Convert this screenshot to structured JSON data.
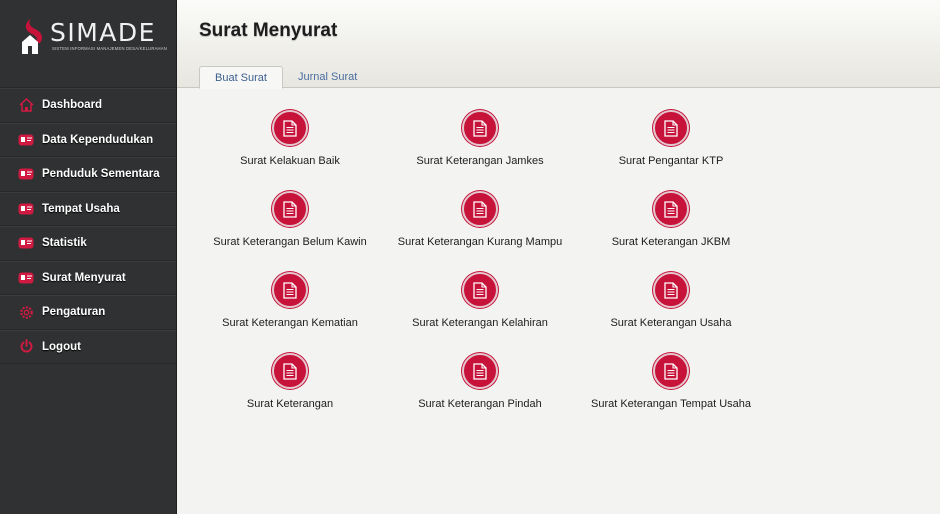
{
  "app": {
    "logo_title": "SIMADE",
    "logo_subtitle": "SISTEM INFORMASI MANAJEMEN DESA/KELURAHAN",
    "brand_color": "#c7123a"
  },
  "sidebar": {
    "items": [
      {
        "label": "Dashboard",
        "icon": "home-icon"
      },
      {
        "label": "Data Kependudukan",
        "icon": "id-card-icon"
      },
      {
        "label": "Penduduk Sementara",
        "icon": "id-card-icon"
      },
      {
        "label": "Tempat Usaha",
        "icon": "id-card-icon"
      },
      {
        "label": "Statistik",
        "icon": "id-card-icon"
      },
      {
        "label": "Surat Menyurat",
        "icon": "id-card-icon"
      },
      {
        "label": "Pengaturan",
        "icon": "gear-icon"
      },
      {
        "label": "Logout",
        "icon": "power-icon"
      }
    ]
  },
  "header": {
    "title": "Surat Menyurat",
    "tabs": [
      {
        "label": "Buat Surat",
        "active": true
      },
      {
        "label": "Jurnal Surat",
        "active": false
      }
    ]
  },
  "letters": [
    {
      "label": "Surat Kelakuan Baik"
    },
    {
      "label": "Surat Keterangan Jamkes"
    },
    {
      "label": "Surat Pengantar KTP"
    },
    {
      "label": "Surat Keterangan Belum Kawin"
    },
    {
      "label": "Surat Keterangan Kurang Mampu"
    },
    {
      "label": "Surat Keterangan JKBM"
    },
    {
      "label": "Surat Keterangan Kematian"
    },
    {
      "label": "Surat Keterangan Kelahiran"
    },
    {
      "label": "Surat Keterangan Usaha"
    },
    {
      "label": "Surat Keterangan"
    },
    {
      "label": "Surat Keterangan Pindah"
    },
    {
      "label": "Surat Keterangan Tempat Usaha"
    }
  ]
}
